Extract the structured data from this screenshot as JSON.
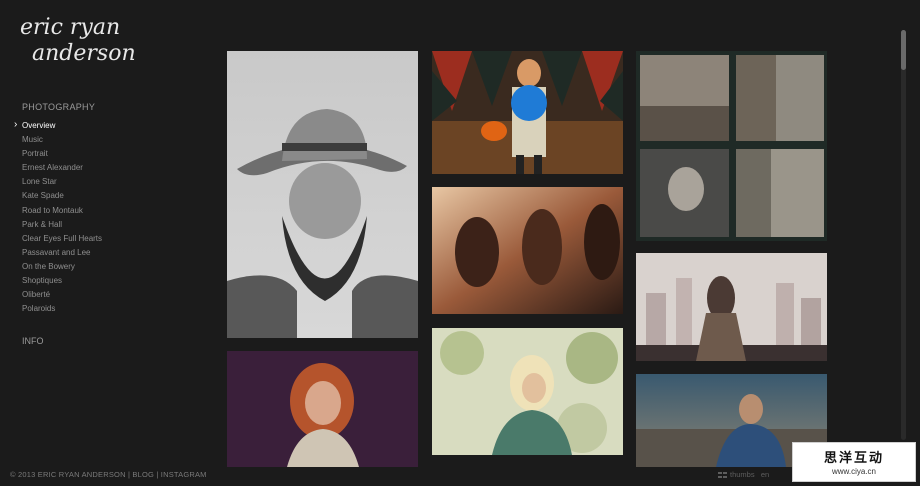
{
  "logo": {
    "line1": "eric ryan",
    "line2": "anderson"
  },
  "nav": {
    "heading": "PHOTOGRAPHY",
    "items": [
      {
        "label": "Overview",
        "active": true
      },
      {
        "label": "Music"
      },
      {
        "label": "Portrait"
      },
      {
        "label": "Ernest Alexander"
      },
      {
        "label": "Lone Star"
      },
      {
        "label": "Kate Spade"
      },
      {
        "label": "Road to Montauk"
      },
      {
        "label": "Park & Hall"
      },
      {
        "label": "Clear Eyes Full Hearts"
      },
      {
        "label": "Passavant and Lee"
      },
      {
        "label": "On the Bowery"
      },
      {
        "label": "Shoptiques"
      },
      {
        "label": "Oliberté"
      },
      {
        "label": "Polaroids"
      }
    ],
    "info": "INFO"
  },
  "footer": {
    "copyright": "© 2013 ERIC RYAN ANDERSON",
    "blog": "BLOG",
    "instagram": "INSTAGRAM",
    "separator": " | ",
    "thumbs": "thumbs",
    "extra": "en"
  },
  "watermark": {
    "text_cn": "思洋互动",
    "url": "www.ciya.cn"
  },
  "colors": {
    "background": "#1b1b1b",
    "active_nav": "#ffffff",
    "nav": "#8f8f8f"
  }
}
